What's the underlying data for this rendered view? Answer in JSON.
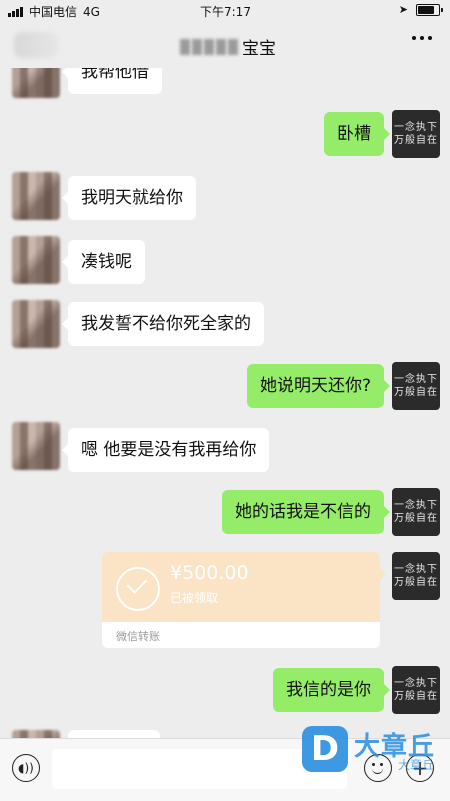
{
  "status_bar": {
    "carrier": "中国电信",
    "network": "4G",
    "time": "下午7:17"
  },
  "nav": {
    "title_suffix": "宝宝",
    "more_icon": "more-dots-icon"
  },
  "messages": [
    {
      "from": "friend",
      "text": "我帮他借"
    },
    {
      "from": "self",
      "text": "卧槽"
    },
    {
      "from": "friend",
      "text": "我明天就给你"
    },
    {
      "from": "friend",
      "text": "凑钱呢"
    },
    {
      "from": "friend",
      "text": "我发誓不给你死全家的"
    },
    {
      "from": "self",
      "text": "她说明天还你?"
    },
    {
      "from": "friend",
      "text": "嗯 他要是没有我再给你"
    },
    {
      "from": "self",
      "text": "她的话我是不信的"
    },
    {
      "from": "self",
      "type": "transfer",
      "amount": "¥500.00",
      "status": "已被领取",
      "label": "微信转账"
    },
    {
      "from": "self",
      "text": "我信的是你"
    }
  ],
  "self_avatar": {
    "line1": "一念执下",
    "line2": "万般自在"
  },
  "input_bar": {
    "voice_icon": "voice-icon",
    "emoji_icon": "emoji-icon",
    "plus_icon": "plus-icon"
  },
  "watermark": {
    "logo": "D",
    "name": "大章丘",
    "sub": "大章丘"
  },
  "colors": {
    "background": "#ededed",
    "self_bubble": "#95ec69",
    "friend_bubble": "#ffffff",
    "transfer": "#fbe3c5"
  }
}
